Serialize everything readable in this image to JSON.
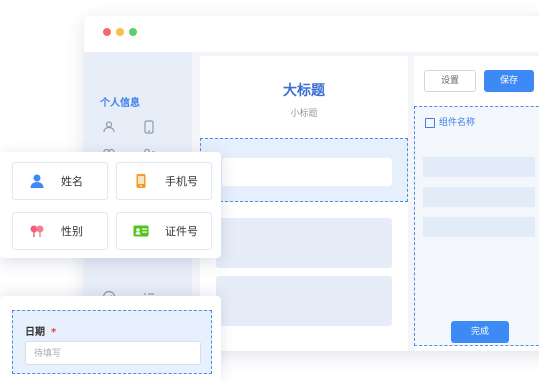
{
  "left_panel": {
    "section_title": "个人信息"
  },
  "canvas": {
    "title": "大标题",
    "subtitle": "小标题"
  },
  "right_panel": {
    "settings_label": "设置",
    "save_label": "保存",
    "component_name": "组件名称",
    "done_label": "完成"
  },
  "fields": [
    {
      "label": "姓名",
      "icon": "person-icon",
      "color": "#3d8af7"
    },
    {
      "label": "手机号",
      "icon": "phone-icon",
      "color": "#f39a2b"
    },
    {
      "label": "性别",
      "icon": "gender-icon",
      "color": "#f0627a"
    },
    {
      "label": "证件号",
      "icon": "id-card-icon",
      "color": "#52c41a"
    }
  ],
  "date_field": {
    "label": "日期",
    "required_mark": "*",
    "placeholder": "待填写"
  },
  "colors": {
    "accent": "#3d8af7",
    "required": "#e53935"
  }
}
